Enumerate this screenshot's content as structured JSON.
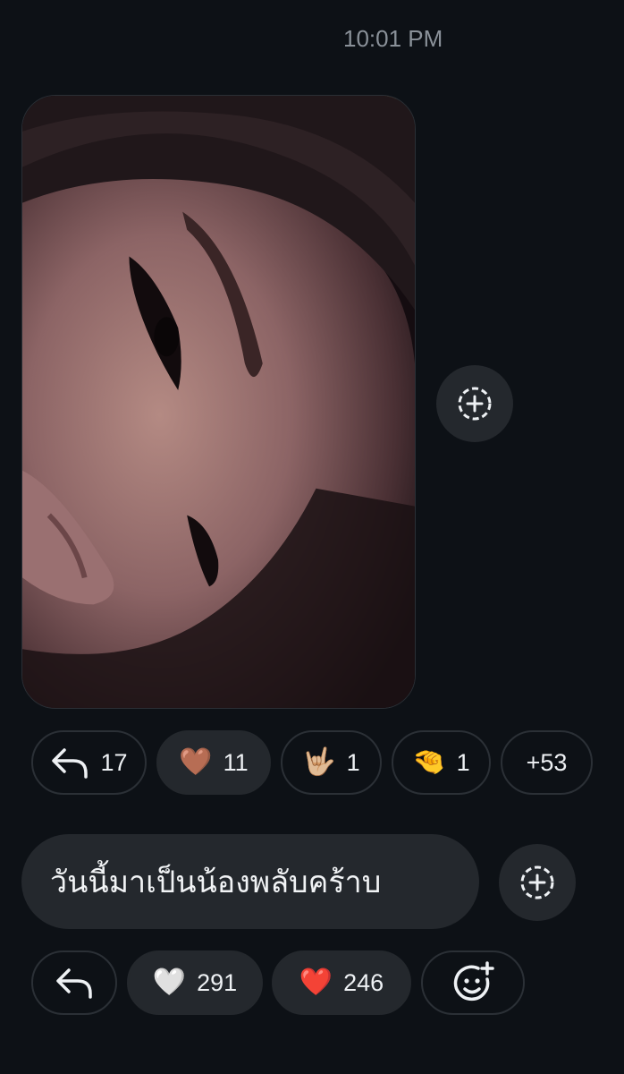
{
  "message": {
    "timestamp": "10:01 PM",
    "text": "วันนี้มาเป็นน้องพลับคร้าบ"
  },
  "photo_reactions": [
    {
      "icon": "reply-icon",
      "count": "17",
      "emoji": ""
    },
    {
      "icon": "brown-heart-icon",
      "count": "11",
      "emoji": "🤎"
    },
    {
      "icon": "love-you-hand-icon",
      "count": "1",
      "emoji": "🤟🏼"
    },
    {
      "icon": "pinching-hand-icon",
      "count": "1",
      "emoji": "🤏"
    },
    {
      "icon": "more-reactions",
      "count": "+53",
      "emoji": ""
    }
  ],
  "text_reactions": [
    {
      "icon": "reply-icon",
      "count": "",
      "emoji": ""
    },
    {
      "icon": "white-heart-icon",
      "count": "291",
      "emoji": "🤍"
    },
    {
      "icon": "red-heart-icon",
      "count": "246",
      "emoji": "❤️"
    },
    {
      "icon": "add-emoji-icon",
      "count": "",
      "emoji": ""
    }
  ]
}
